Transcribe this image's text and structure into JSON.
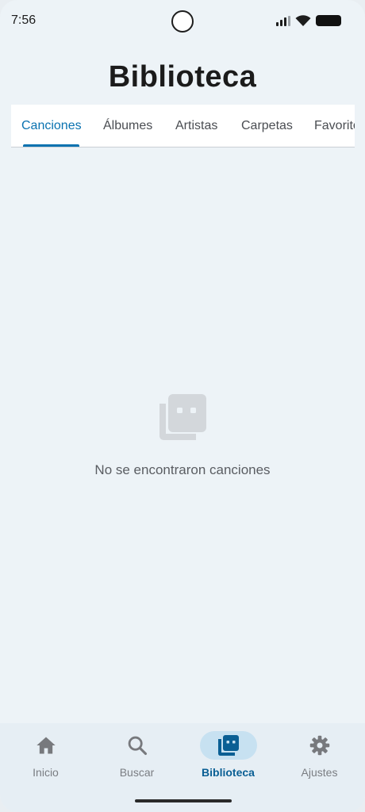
{
  "status_bar": {
    "time": "7:56"
  },
  "header": {
    "title": "Biblioteca"
  },
  "tabs": [
    {
      "label": "Canciones",
      "active": true
    },
    {
      "label": "Álbumes",
      "active": false
    },
    {
      "label": "Artistas",
      "active": false
    },
    {
      "label": "Carpetas",
      "active": false
    },
    {
      "label": "Favoritos",
      "active": false
    }
  ],
  "empty_state": {
    "icon": "library-music-icon",
    "message": "No se encontraron canciones"
  },
  "bottom_nav": [
    {
      "label": "Inicio",
      "icon": "home-icon",
      "active": false
    },
    {
      "label": "Buscar",
      "icon": "search-icon",
      "active": false
    },
    {
      "label": "Biblioteca",
      "icon": "library-icon",
      "active": true
    },
    {
      "label": "Ajustes",
      "icon": "gear-icon",
      "active": false
    }
  ],
  "colors": {
    "accent": "#0a72b0",
    "active_pill": "#c7e1f1",
    "background": "#edf3f7"
  }
}
